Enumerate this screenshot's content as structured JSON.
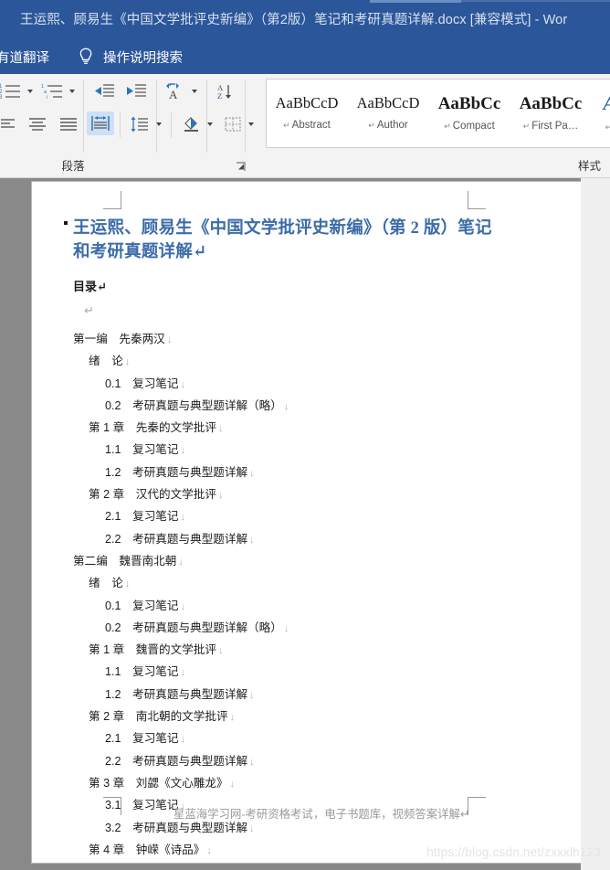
{
  "titlebar": {
    "document_title": "王运熙、顾易生《中国文学批评史新编》（第2版）笔记和考研真题详解.docx [兼容模式]  -  Wor",
    "background_color": "#2b579a"
  },
  "tellme": {
    "youdao_label": "有道翻译",
    "bulb_icon": "lightbulb-icon",
    "search_label": "操作说明搜索"
  },
  "ribbon": {
    "paragraph_group": {
      "label": "段落",
      "buttons": [
        {
          "name": "numbering",
          "icon": "numbered-list-icon",
          "has_caret": true
        },
        {
          "name": "multilevel-list",
          "icon": "multilevel-list-icon",
          "has_caret": true
        },
        {
          "name": "decrease-indent",
          "icon": "decrease-indent-icon",
          "has_caret": false
        },
        {
          "name": "increase-indent",
          "icon": "increase-indent-icon",
          "has_caret": false
        },
        {
          "name": "asian-layout",
          "icon": "asian-layout-icon",
          "has_caret": true
        },
        {
          "name": "sort",
          "icon": "sort-az-icon",
          "has_caret": false
        },
        {
          "name": "show-formatting-marks",
          "icon": "pilcrow-icon",
          "has_caret": false
        },
        {
          "name": "align-center",
          "icon": "align-center-icon",
          "has_caret": false
        },
        {
          "name": "align-justify",
          "icon": "align-justify-icon",
          "has_caret": false
        },
        {
          "name": "distribute",
          "icon": "distributed-align-icon",
          "has_caret": false
        },
        {
          "name": "line-spacing",
          "icon": "line-spacing-icon",
          "has_caret": true
        },
        {
          "name": "shading",
          "icon": "paint-bucket-icon",
          "has_caret": true
        },
        {
          "name": "borders",
          "icon": "borders-icon",
          "has_caret": true
        }
      ],
      "dialog_launcher": "dialog-box-launcher"
    },
    "styles_group": {
      "label": "样式",
      "items": [
        {
          "preview": "AaBbCcD",
          "name": "Abstract",
          "mark": "↵"
        },
        {
          "preview": "AaBbCcD",
          "name": "Author",
          "mark": "↵"
        },
        {
          "preview": "AaBbCc",
          "name": "Compact",
          "mark": "↵"
        },
        {
          "preview": "AaBbCc",
          "name": "First Pa…",
          "mark": "↵"
        },
        {
          "preview": "A",
          "name": "",
          "mark": ""
        }
      ]
    }
  },
  "document": {
    "title": "王运熙、顾易生《中国文学批评史新编》（第 2 版）笔记和考研真题详解↵",
    "toc_label": "目录↵",
    "blank_line": "↵",
    "toc": [
      {
        "level": 0,
        "text": "第一编　先秦两汉"
      },
      {
        "level": 1,
        "text": "绪　论"
      },
      {
        "level": 2,
        "text": "0.1　复习笔记"
      },
      {
        "level": 2,
        "text": "0.2　考研真题与典型题详解（略）"
      },
      {
        "level": 1,
        "text": "第 1 章　先秦的文学批评"
      },
      {
        "level": 2,
        "text": "1.1　复习笔记"
      },
      {
        "level": 2,
        "text": "1.2　考研真题与典型题详解"
      },
      {
        "level": 1,
        "text": "第 2 章　汉代的文学批评"
      },
      {
        "level": 2,
        "text": "2.1　复习笔记"
      },
      {
        "level": 2,
        "text": "2.2　考研真题与典型题详解"
      },
      {
        "level": 0,
        "text": "第二编　魏晋南北朝"
      },
      {
        "level": 1,
        "text": "绪　论"
      },
      {
        "level": 2,
        "text": "0.1　复习笔记"
      },
      {
        "level": 2,
        "text": "0.2　考研真题与典型题详解（略）"
      },
      {
        "level": 1,
        "text": "第 1 章　魏晋的文学批评"
      },
      {
        "level": 2,
        "text": "1.1　复习笔记"
      },
      {
        "level": 2,
        "text": "1.2　考研真题与典型题详解"
      },
      {
        "level": 1,
        "text": "第 2 章　南北朝的文学批评"
      },
      {
        "level": 2,
        "text": "2.1　复习笔记"
      },
      {
        "level": 2,
        "text": "2.2　考研真题与典型题详解"
      },
      {
        "level": 1,
        "text": "第 3 章　刘勰《文心雕龙》"
      },
      {
        "level": 2,
        "text": "3.1　复习笔记"
      },
      {
        "level": 2,
        "text": "3.2　考研真题与典型题详解"
      },
      {
        "level": 1,
        "text": "第 4 章　钟嵘《诗品》"
      }
    ],
    "footer": "星蓝海学习网-考研资格考试，电子书题库，视频答案详解↵"
  },
  "watermark": "https://blog.csdn.net/zxxxlh123"
}
